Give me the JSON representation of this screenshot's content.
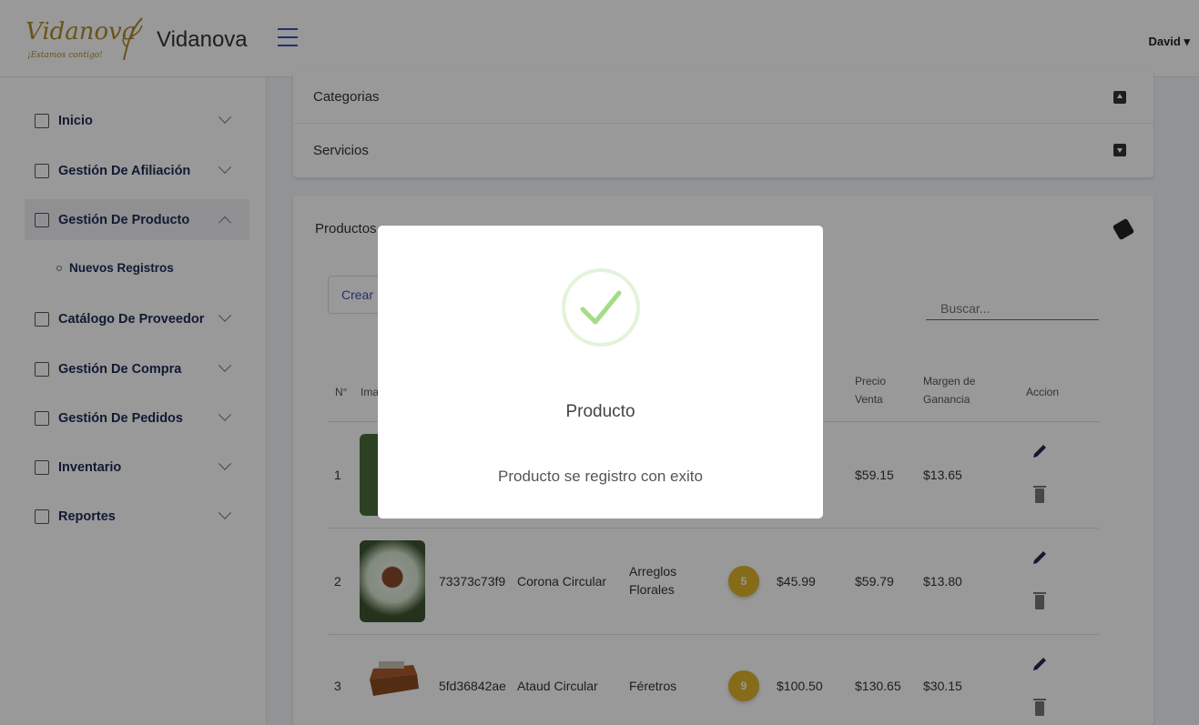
{
  "header": {
    "logo_script": "Vidanova",
    "logo_tagline": "¡Estamos contigo!",
    "brand": "Vidanova",
    "user": "David ▾"
  },
  "sidebar": {
    "items": [
      {
        "label": "Inicio",
        "icon": "grid-icon"
      },
      {
        "label": "Gestión De Afiliación",
        "icon": "document-icon"
      },
      {
        "label": "Gestión De Producto",
        "icon": "box-icon"
      },
      {
        "label": "Catálogo De Proveedor",
        "icon": "document-icon"
      },
      {
        "label": "Gestión De Compra",
        "icon": "truck-icon"
      },
      {
        "label": "Gestión De Pedidos",
        "icon": "box-icon"
      },
      {
        "label": "Inventario",
        "icon": "list-icon"
      },
      {
        "label": "Reportes",
        "icon": "file-icon"
      }
    ],
    "sub_item": "Nuevos Registros"
  },
  "accordion": {
    "categorias": "Categorias",
    "servicios": "Servicios"
  },
  "productos": {
    "title": "Productos",
    "crear_label": "Crear N",
    "search_placeholder": "Buscar...",
    "headers": {
      "n": "N°",
      "img": "Ima",
      "precio_venta": "Precio Venta",
      "margen": "Margen de Ganancia",
      "accion": "Accion"
    },
    "rows": [
      {
        "n": "1",
        "code": "",
        "name": "",
        "category": "",
        "stock": "",
        "cost": "",
        "price": "$59.15",
        "margin": "$13.65"
      },
      {
        "n": "2",
        "code": "73373c73f9",
        "name": "Corona Circular",
        "category": "Arreglos Florales",
        "stock": "5",
        "cost": "$45.99",
        "price": "$59.79",
        "margin": "$13.80"
      },
      {
        "n": "3",
        "code": "5fd36842ae",
        "name": "Ataud Circular",
        "category": "Féretros",
        "stock": "9",
        "cost": "$100.50",
        "price": "$130.65",
        "margin": "$30.15"
      }
    ]
  },
  "modal": {
    "title": "Producto",
    "message": "Producto se registro con exito"
  },
  "colors": {
    "accent": "#3f51b5",
    "badge": "#e0b22a",
    "success": "#a5dc86"
  }
}
